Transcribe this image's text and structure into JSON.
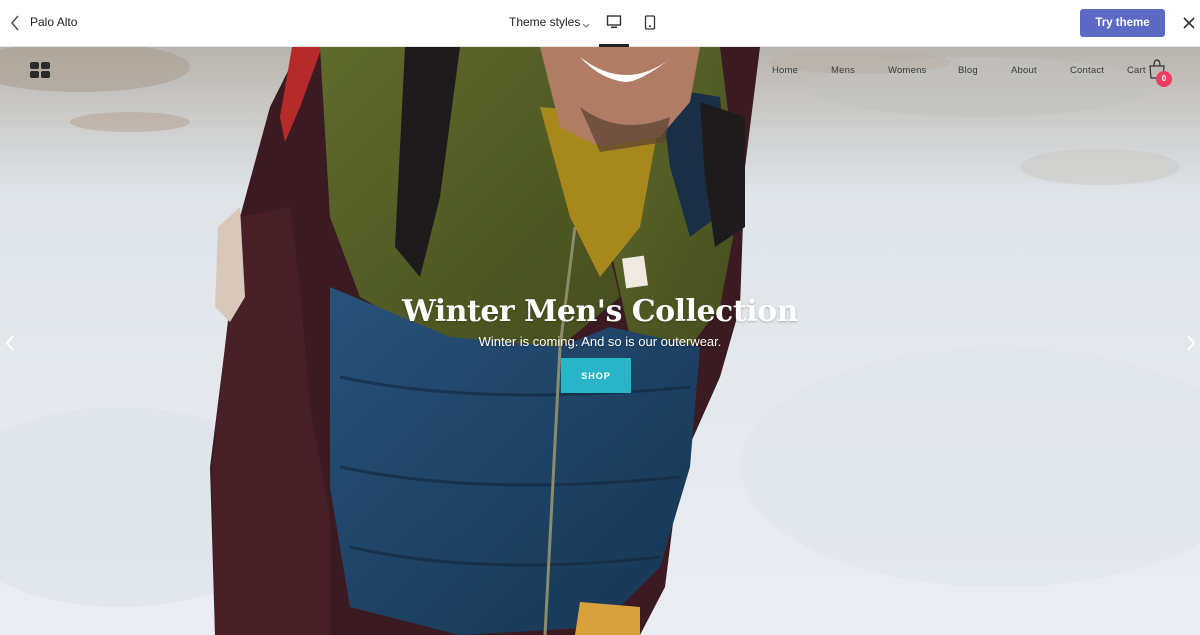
{
  "editor": {
    "store_name": "Palo Alto",
    "theme_styles_label": "Theme styles",
    "try_theme_label": "Try theme",
    "accent_color": "#5c6ac4"
  },
  "storefront": {
    "nav": [
      "Home",
      "Mens",
      "Womens",
      "Blog",
      "About",
      "Contact"
    ],
    "cart_label": "Cart",
    "cart_count": "0",
    "badge_color": "#ee3d63"
  },
  "hero": {
    "title": "Winter Men's Collection",
    "subtitle": "Winter is coming. And so is our outerwear.",
    "button_label": "SHOP",
    "button_color": "#29b5c8"
  },
  "icons": [
    "chevron-left-icon",
    "chevron-down-icon",
    "desktop-icon",
    "mobile-icon",
    "close-icon",
    "logo-icon",
    "cart-icon",
    "arrow-left-icon",
    "arrow-right-icon"
  ]
}
